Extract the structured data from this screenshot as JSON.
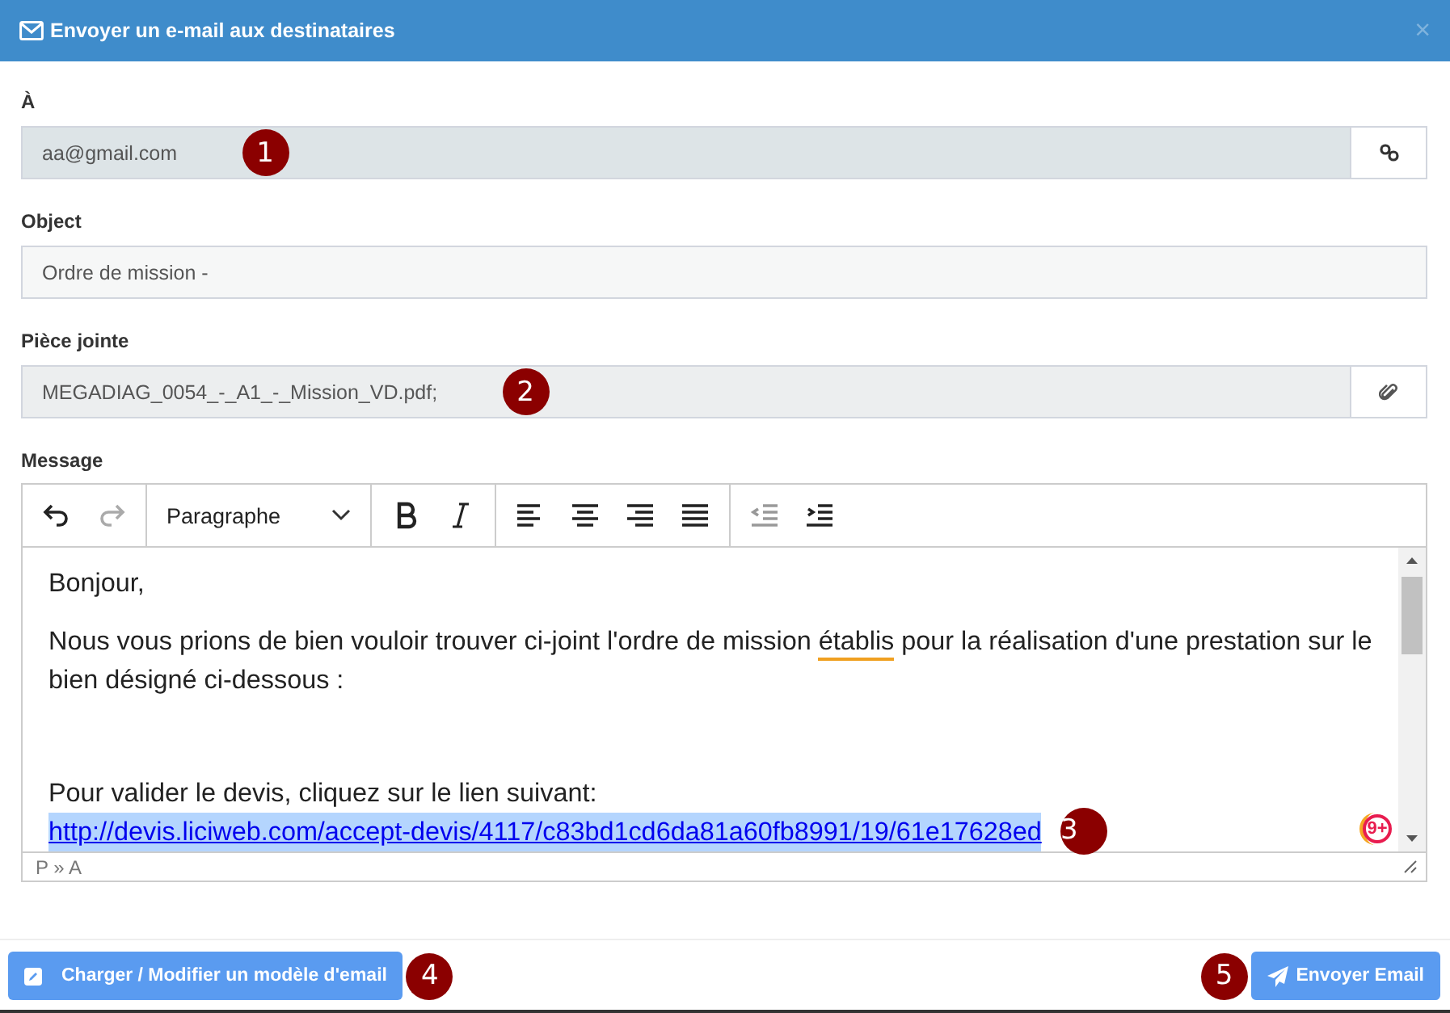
{
  "window": {
    "title": "Envoyer un e-mail aux destinataires",
    "close": "×"
  },
  "fields": [
    {
      "kind": "recipients",
      "label": "À",
      "value": "aa@gmail.com",
      "marker": "1"
    },
    {
      "kind": "subject",
      "label": "Object",
      "value": "Ordre de mission -"
    },
    {
      "kind": "attachment",
      "label": "Pièce jointe",
      "value": "MEGADIAG_0054_-_A1_-_Mission_VD.pdf;",
      "marker": "2"
    }
  ],
  "message": {
    "label": "Message",
    "block_format": "Paragraphe",
    "paragraphs": [
      {
        "kind": "text",
        "segments": [
          {
            "text": "Bonjour,",
            "misspelled": false
          }
        ]
      },
      {
        "kind": "text",
        "segments": [
          {
            "text": "Nous vous prions de bien vouloir trouver ci-joint l'ordre de mission ",
            "misspelled": false
          },
          {
            "text": "établis",
            "misspelled": true
          },
          {
            "text": " pour la réalisation d'une prestation sur le bien désigné ci-dessous :",
            "misspelled": false
          }
        ]
      },
      {
        "kind": "blank"
      },
      {
        "kind": "text",
        "segments": [
          {
            "text": "Pour valider le devis, cliquez sur le lien suivant: ",
            "misspelled": false
          }
        ],
        "link": "http://devis.liciweb.com/accept-devis/4117/c83bd1cd6da81a60fb8991/19/61e17628ed",
        "marker": "3"
      }
    ],
    "path": "P » A",
    "grammar_badge": "9+"
  },
  "footer": {
    "template_button": {
      "label": "Charger / Modifier un modèle d'email",
      "marker": "4"
    },
    "send_button": {
      "label": "Envoyer Email",
      "marker": "5"
    }
  }
}
